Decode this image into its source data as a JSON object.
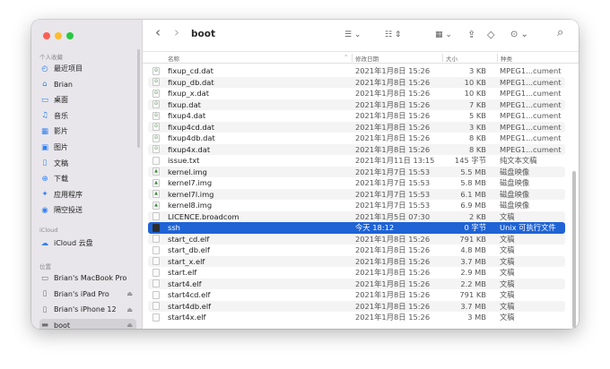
{
  "window": {
    "title": "boot"
  },
  "sidebar": {
    "favorites_label": "个人收藏",
    "favorites": [
      {
        "label": "最近项目",
        "icon": "clock-icon",
        "glyph": "◴"
      },
      {
        "label": "Brian",
        "icon": "home-icon",
        "glyph": "⌂"
      },
      {
        "label": "桌面",
        "icon": "desktop-icon",
        "glyph": "▭"
      },
      {
        "label": "音乐",
        "icon": "music-icon",
        "glyph": "♫"
      },
      {
        "label": "影片",
        "icon": "film-icon",
        "glyph": "▦"
      },
      {
        "label": "图片",
        "icon": "photo-icon",
        "glyph": "▣"
      },
      {
        "label": "文稿",
        "icon": "document-icon",
        "glyph": "▯"
      },
      {
        "label": "下载",
        "icon": "download-icon",
        "glyph": "⊕"
      },
      {
        "label": "应用程序",
        "icon": "apps-icon",
        "glyph": "✦"
      },
      {
        "label": "隔空投送",
        "icon": "airdrop-icon",
        "glyph": "◉"
      }
    ],
    "icloud_label": "iCloud",
    "icloud": [
      {
        "label": "iCloud 云盘",
        "icon": "cloud-icon",
        "glyph": "☁"
      }
    ],
    "locations_label": "位置",
    "locations": [
      {
        "label": "Brian's MacBook Pro",
        "icon": "laptop-icon",
        "glyph": "▭",
        "eject": ""
      },
      {
        "label": "Brian's iPad Pro",
        "icon": "ipad-icon",
        "glyph": "▯",
        "eject": "⏏"
      },
      {
        "label": "Brian's iPhone 12",
        "icon": "iphone-icon",
        "glyph": "▯",
        "eject": "⏏"
      },
      {
        "label": "boot",
        "icon": "disk-icon",
        "glyph": "▬",
        "eject": "⏏"
      }
    ]
  },
  "toolbar": {
    "back_glyph": "‹",
    "forward_glyph": "›",
    "view_glyph": "☰ ⌄",
    "group_glyph": "☷ ⇕",
    "gallery_glyph": "▦ ⌄",
    "share_glyph": "⇪",
    "tag_glyph": "◇",
    "more_glyph": "⊙ ⌄",
    "search_glyph": "⌕"
  },
  "columns": {
    "name": "名称",
    "date": "修改日期",
    "size": "大小",
    "kind": "种类",
    "sort_glyph": "⌃"
  },
  "files": [
    {
      "name": "fixup_cd.dat",
      "date": "2021年1月8日 15:26",
      "size": "3 KB",
      "kind": "MPEG1...cument",
      "glyph": "⊙"
    },
    {
      "name": "fixup_db.dat",
      "date": "2021年1月8日 15:26",
      "size": "10 KB",
      "kind": "MPEG1...cument",
      "glyph": "⊙"
    },
    {
      "name": "fixup_x.dat",
      "date": "2021年1月8日 15:26",
      "size": "10 KB",
      "kind": "MPEG1...cument",
      "glyph": "⊙"
    },
    {
      "name": "fixup.dat",
      "date": "2021年1月8日 15:26",
      "size": "7 KB",
      "kind": "MPEG1...cument",
      "glyph": "⊙"
    },
    {
      "name": "fixup4.dat",
      "date": "2021年1月8日 15:26",
      "size": "5 KB",
      "kind": "MPEG1...cument",
      "glyph": "⊙"
    },
    {
      "name": "fixup4cd.dat",
      "date": "2021年1月8日 15:26",
      "size": "3 KB",
      "kind": "MPEG1...cument",
      "glyph": "⊙"
    },
    {
      "name": "fixup4db.dat",
      "date": "2021年1月8日 15:26",
      "size": "8 KB",
      "kind": "MPEG1...cument",
      "glyph": "⊙"
    },
    {
      "name": "fixup4x.dat",
      "date": "2021年1月8日 15:26",
      "size": "8 KB",
      "kind": "MPEG1...cument",
      "glyph": "⊙"
    },
    {
      "name": "issue.txt",
      "date": "2021年1月11日 13:15",
      "size": "145 字节",
      "kind": "纯文本文稿",
      "glyph": ""
    },
    {
      "name": "kernel.img",
      "date": "2021年1月7日 15:53",
      "size": "5.5 MB",
      "kind": "磁盘映像",
      "glyph": "▲"
    },
    {
      "name": "kernel7.img",
      "date": "2021年1月7日 15:53",
      "size": "5.8 MB",
      "kind": "磁盘映像",
      "glyph": "▲"
    },
    {
      "name": "kernel7l.img",
      "date": "2021年1月7日 15:53",
      "size": "6.1 MB",
      "kind": "磁盘映像",
      "glyph": "▲"
    },
    {
      "name": "kernel8.img",
      "date": "2021年1月7日 15:53",
      "size": "6.9 MB",
      "kind": "磁盘映像",
      "glyph": "▲"
    },
    {
      "name": "LICENCE.broadcom",
      "date": "2021年1月5日 07:30",
      "size": "2 KB",
      "kind": "文稿",
      "glyph": ""
    },
    {
      "name": "ssh",
      "date": "今天 18:12",
      "size": "0 字节",
      "kind": "Unix 可执行文件",
      "glyph": "exec"
    },
    {
      "name": "start_cd.elf",
      "date": "2021年1月8日 15:26",
      "size": "791 KB",
      "kind": "文稿",
      "glyph": ""
    },
    {
      "name": "start_db.elf",
      "date": "2021年1月8日 15:26",
      "size": "4.8 MB",
      "kind": "文稿",
      "glyph": ""
    },
    {
      "name": "start_x.elf",
      "date": "2021年1月8日 15:26",
      "size": "3.7 MB",
      "kind": "文稿",
      "glyph": ""
    },
    {
      "name": "start.elf",
      "date": "2021年1月8日 15:26",
      "size": "2.9 MB",
      "kind": "文稿",
      "glyph": ""
    },
    {
      "name": "start4.elf",
      "date": "2021年1月8日 15:26",
      "size": "2.2 MB",
      "kind": "文稿",
      "glyph": ""
    },
    {
      "name": "start4cd.elf",
      "date": "2021年1月8日 15:26",
      "size": "791 KB",
      "kind": "文稿",
      "glyph": ""
    },
    {
      "name": "start4db.elf",
      "date": "2021年1月8日 15:26",
      "size": "3.7 MB",
      "kind": "文稿",
      "glyph": ""
    },
    {
      "name": "start4x.elf",
      "date": "2021年1月8日 15:26",
      "size": "3 MB",
      "kind": "文稿",
      "glyph": ""
    }
  ],
  "selected_file": "ssh",
  "colors": {
    "selection": "#1f63d5",
    "accent": "#2f7ff5"
  }
}
